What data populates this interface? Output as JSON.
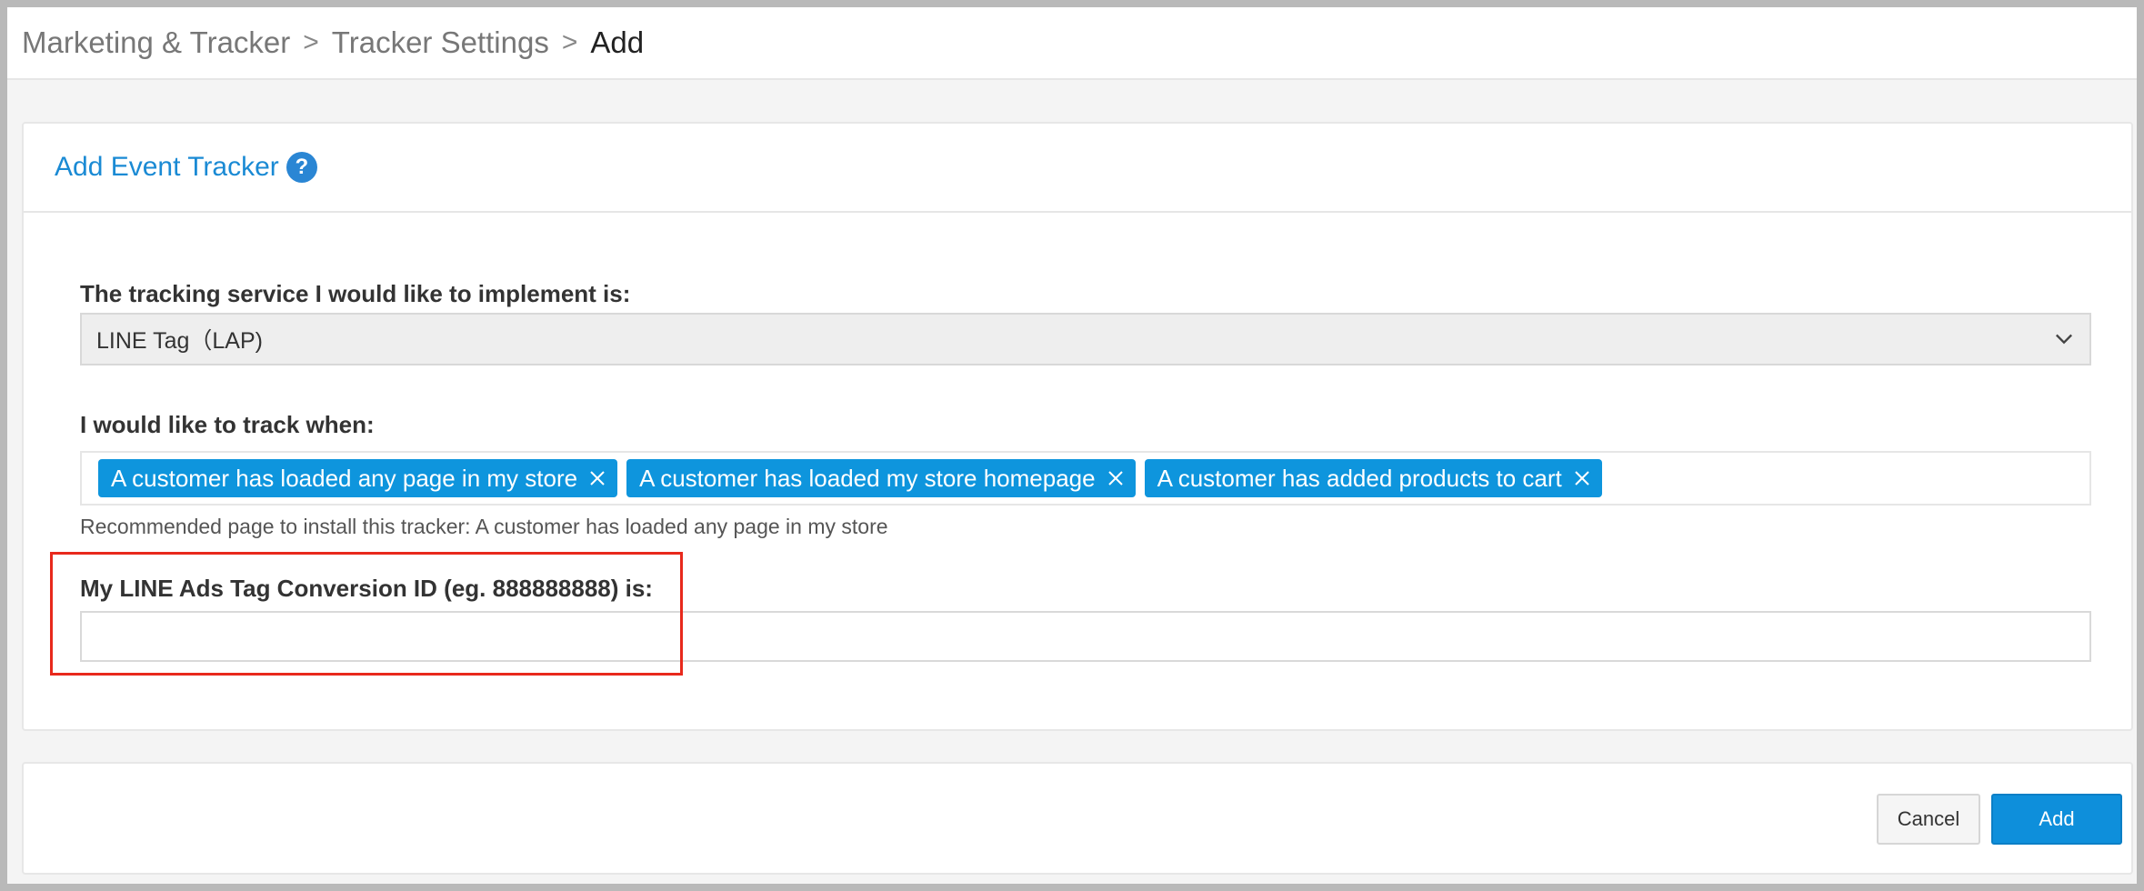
{
  "breadcrumb": {
    "items": [
      "Marketing & Tracker",
      "Tracker Settings"
    ],
    "current": "Add",
    "separator": ">"
  },
  "panel": {
    "title": "Add Event Tracker",
    "help_icon": "question-circle-icon"
  },
  "service": {
    "label": "The tracking service I would like to implement is:",
    "selected": "LINE Tag（LAP)"
  },
  "track": {
    "label": "I would like to track when:",
    "tags": [
      "A customer has loaded any page in my store",
      "A customer has loaded my store homepage",
      "A customer has added products to cart"
    ],
    "hint": "Recommended page to install this tracker: A customer has loaded any page in my store"
  },
  "conversion": {
    "label": "My LINE Ads Tag Conversion ID (eg. 888888888) is:",
    "value": "",
    "placeholder": ""
  },
  "actions": {
    "cancel_label": "Cancel",
    "add_label": "Add"
  },
  "colors": {
    "accent": "#0e95dd",
    "highlight": "#e8291c",
    "title": "#1a8ad4"
  }
}
